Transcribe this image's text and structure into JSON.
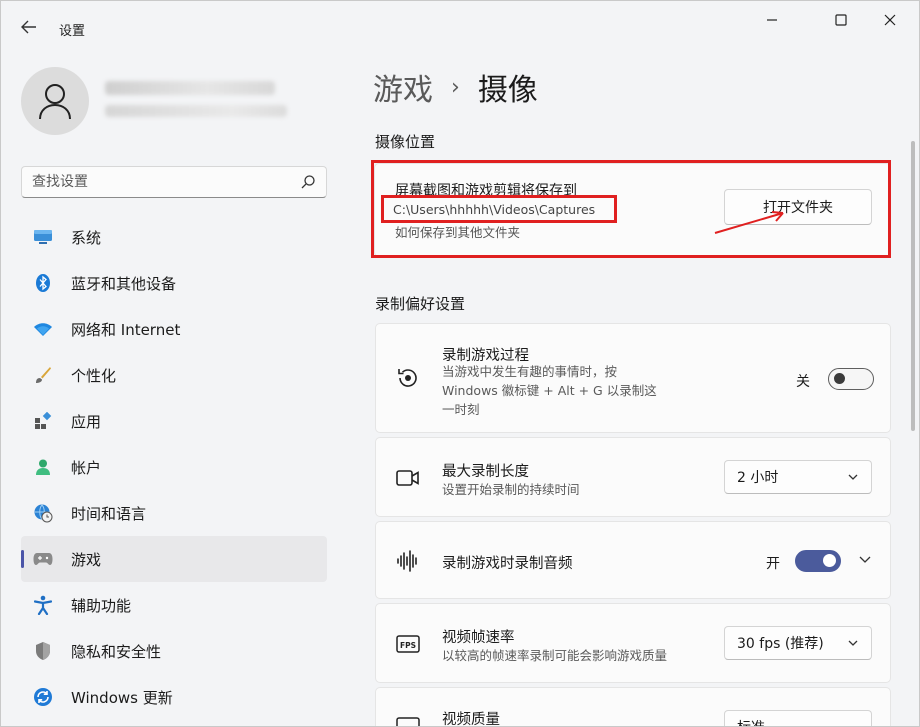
{
  "window": {
    "title": "设置"
  },
  "sidebar": {
    "search_placeholder": "查找设置",
    "items": [
      {
        "label": "系统",
        "icon": "monitor-icon"
      },
      {
        "label": "蓝牙和其他设备",
        "icon": "bluetooth-icon"
      },
      {
        "label": "网络和 Internet",
        "icon": "wifi-icon"
      },
      {
        "label": "个性化",
        "icon": "brush-icon"
      },
      {
        "label": "应用",
        "icon": "apps-icon"
      },
      {
        "label": "帐户",
        "icon": "person-icon"
      },
      {
        "label": "时间和语言",
        "icon": "globe-clock-icon"
      },
      {
        "label": "游戏",
        "icon": "gamepad-icon",
        "active": true
      },
      {
        "label": "辅助功能",
        "icon": "accessibility-icon"
      },
      {
        "label": "隐私和安全性",
        "icon": "shield-icon"
      },
      {
        "label": "Windows 更新",
        "icon": "update-icon"
      }
    ]
  },
  "breadcrumb": {
    "parent": "游戏",
    "separator": "›",
    "current": "摄像"
  },
  "capture_location": {
    "section_title": "摄像位置",
    "title": "屏幕截图和游戏剪辑将保存到",
    "path": "C:\\Users\\hhhhh\\Videos\\Captures",
    "link": "如何保存到其他文件夹",
    "open_folder_button": "打开文件夹"
  },
  "recording": {
    "section_title": "录制偏好设置",
    "background": {
      "title": "录制游戏过程",
      "desc_lines": [
        "当游戏中发生有趣的事情时，按",
        "Windows 徽标键 + Alt + G 以录制这",
        "一时刻"
      ],
      "toggle_label": "关",
      "toggle_on": false
    },
    "max_length": {
      "title": "最大录制长度",
      "desc": "设置开始录制的持续时间",
      "value": "2 小时"
    },
    "audio": {
      "title": "录制游戏时录制音频",
      "toggle_label": "开",
      "toggle_on": true
    },
    "fps": {
      "title": "视频帧速率",
      "desc": "以较高的帧速率录制可能会影响游戏质量",
      "value": "30 fps (推荐)"
    },
    "quality": {
      "title": "视频质量",
      "value": "标准"
    }
  },
  "colors": {
    "accent": "#4b5b9c",
    "highlight": "#e02020"
  }
}
